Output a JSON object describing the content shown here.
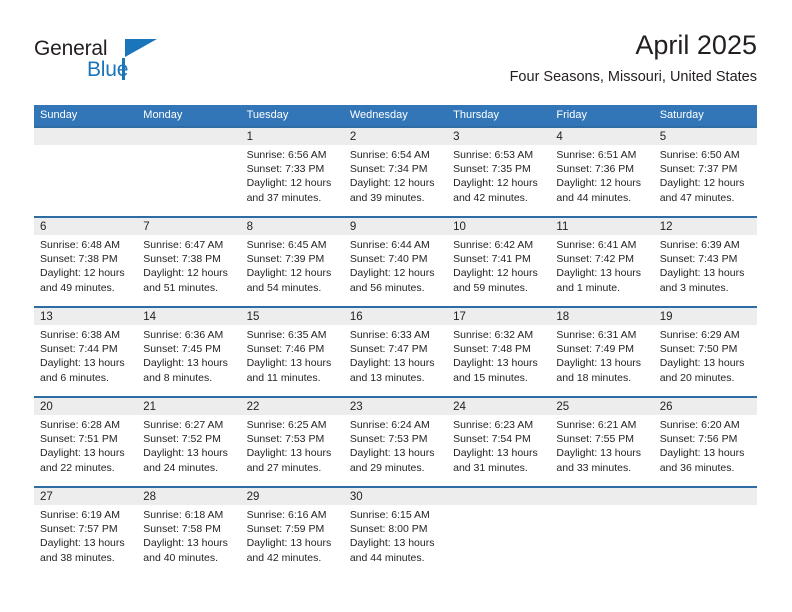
{
  "logo": {
    "word_primary": "General",
    "word_secondary": "Blue",
    "triangle_icon": "triangle-icon"
  },
  "header": {
    "title": "April 2025",
    "subtitle": "Four Seasons, Missouri, United States"
  },
  "colors": {
    "header_blue": "#3276b8",
    "week_separator_blue": "#2e6da4",
    "daynum_background": "#ededed",
    "logo_blue": "#1b75bb",
    "text": "#231f20"
  },
  "calendar": {
    "weekday_headers": [
      "Sunday",
      "Monday",
      "Tuesday",
      "Wednesday",
      "Thursday",
      "Friday",
      "Saturday"
    ],
    "weeks": [
      [
        {
          "day": "",
          "lines": []
        },
        {
          "day": "",
          "lines": []
        },
        {
          "day": "1",
          "lines": [
            "Sunrise: 6:56 AM",
            "Sunset: 7:33 PM",
            "Daylight: 12 hours",
            "and 37 minutes."
          ]
        },
        {
          "day": "2",
          "lines": [
            "Sunrise: 6:54 AM",
            "Sunset: 7:34 PM",
            "Daylight: 12 hours",
            "and 39 minutes."
          ]
        },
        {
          "day": "3",
          "lines": [
            "Sunrise: 6:53 AM",
            "Sunset: 7:35 PM",
            "Daylight: 12 hours",
            "and 42 minutes."
          ]
        },
        {
          "day": "4",
          "lines": [
            "Sunrise: 6:51 AM",
            "Sunset: 7:36 PM",
            "Daylight: 12 hours",
            "and 44 minutes."
          ]
        },
        {
          "day": "5",
          "lines": [
            "Sunrise: 6:50 AM",
            "Sunset: 7:37 PM",
            "Daylight: 12 hours",
            "and 47 minutes."
          ]
        }
      ],
      [
        {
          "day": "6",
          "lines": [
            "Sunrise: 6:48 AM",
            "Sunset: 7:38 PM",
            "Daylight: 12 hours",
            "and 49 minutes."
          ]
        },
        {
          "day": "7",
          "lines": [
            "Sunrise: 6:47 AM",
            "Sunset: 7:38 PM",
            "Daylight: 12 hours",
            "and 51 minutes."
          ]
        },
        {
          "day": "8",
          "lines": [
            "Sunrise: 6:45 AM",
            "Sunset: 7:39 PM",
            "Daylight: 12 hours",
            "and 54 minutes."
          ]
        },
        {
          "day": "9",
          "lines": [
            "Sunrise: 6:44 AM",
            "Sunset: 7:40 PM",
            "Daylight: 12 hours",
            "and 56 minutes."
          ]
        },
        {
          "day": "10",
          "lines": [
            "Sunrise: 6:42 AM",
            "Sunset: 7:41 PM",
            "Daylight: 12 hours",
            "and 59 minutes."
          ]
        },
        {
          "day": "11",
          "lines": [
            "Sunrise: 6:41 AM",
            "Sunset: 7:42 PM",
            "Daylight: 13 hours",
            "and 1 minute."
          ]
        },
        {
          "day": "12",
          "lines": [
            "Sunrise: 6:39 AM",
            "Sunset: 7:43 PM",
            "Daylight: 13 hours",
            "and 3 minutes."
          ]
        }
      ],
      [
        {
          "day": "13",
          "lines": [
            "Sunrise: 6:38 AM",
            "Sunset: 7:44 PM",
            "Daylight: 13 hours",
            "and 6 minutes."
          ]
        },
        {
          "day": "14",
          "lines": [
            "Sunrise: 6:36 AM",
            "Sunset: 7:45 PM",
            "Daylight: 13 hours",
            "and 8 minutes."
          ]
        },
        {
          "day": "15",
          "lines": [
            "Sunrise: 6:35 AM",
            "Sunset: 7:46 PM",
            "Daylight: 13 hours",
            "and 11 minutes."
          ]
        },
        {
          "day": "16",
          "lines": [
            "Sunrise: 6:33 AM",
            "Sunset: 7:47 PM",
            "Daylight: 13 hours",
            "and 13 minutes."
          ]
        },
        {
          "day": "17",
          "lines": [
            "Sunrise: 6:32 AM",
            "Sunset: 7:48 PM",
            "Daylight: 13 hours",
            "and 15 minutes."
          ]
        },
        {
          "day": "18",
          "lines": [
            "Sunrise: 6:31 AM",
            "Sunset: 7:49 PM",
            "Daylight: 13 hours",
            "and 18 minutes."
          ]
        },
        {
          "day": "19",
          "lines": [
            "Sunrise: 6:29 AM",
            "Sunset: 7:50 PM",
            "Daylight: 13 hours",
            "and 20 minutes."
          ]
        }
      ],
      [
        {
          "day": "20",
          "lines": [
            "Sunrise: 6:28 AM",
            "Sunset: 7:51 PM",
            "Daylight: 13 hours",
            "and 22 minutes."
          ]
        },
        {
          "day": "21",
          "lines": [
            "Sunrise: 6:27 AM",
            "Sunset: 7:52 PM",
            "Daylight: 13 hours",
            "and 24 minutes."
          ]
        },
        {
          "day": "22",
          "lines": [
            "Sunrise: 6:25 AM",
            "Sunset: 7:53 PM",
            "Daylight: 13 hours",
            "and 27 minutes."
          ]
        },
        {
          "day": "23",
          "lines": [
            "Sunrise: 6:24 AM",
            "Sunset: 7:53 PM",
            "Daylight: 13 hours",
            "and 29 minutes."
          ]
        },
        {
          "day": "24",
          "lines": [
            "Sunrise: 6:23 AM",
            "Sunset: 7:54 PM",
            "Daylight: 13 hours",
            "and 31 minutes."
          ]
        },
        {
          "day": "25",
          "lines": [
            "Sunrise: 6:21 AM",
            "Sunset: 7:55 PM",
            "Daylight: 13 hours",
            "and 33 minutes."
          ]
        },
        {
          "day": "26",
          "lines": [
            "Sunrise: 6:20 AM",
            "Sunset: 7:56 PM",
            "Daylight: 13 hours",
            "and 36 minutes."
          ]
        }
      ],
      [
        {
          "day": "27",
          "lines": [
            "Sunrise: 6:19 AM",
            "Sunset: 7:57 PM",
            "Daylight: 13 hours",
            "and 38 minutes."
          ]
        },
        {
          "day": "28",
          "lines": [
            "Sunrise: 6:18 AM",
            "Sunset: 7:58 PM",
            "Daylight: 13 hours",
            "and 40 minutes."
          ]
        },
        {
          "day": "29",
          "lines": [
            "Sunrise: 6:16 AM",
            "Sunset: 7:59 PM",
            "Daylight: 13 hours",
            "and 42 minutes."
          ]
        },
        {
          "day": "30",
          "lines": [
            "Sunrise: 6:15 AM",
            "Sunset: 8:00 PM",
            "Daylight: 13 hours",
            "and 44 minutes."
          ]
        },
        {
          "day": "",
          "lines": []
        },
        {
          "day": "",
          "lines": []
        },
        {
          "day": "",
          "lines": []
        }
      ]
    ]
  }
}
